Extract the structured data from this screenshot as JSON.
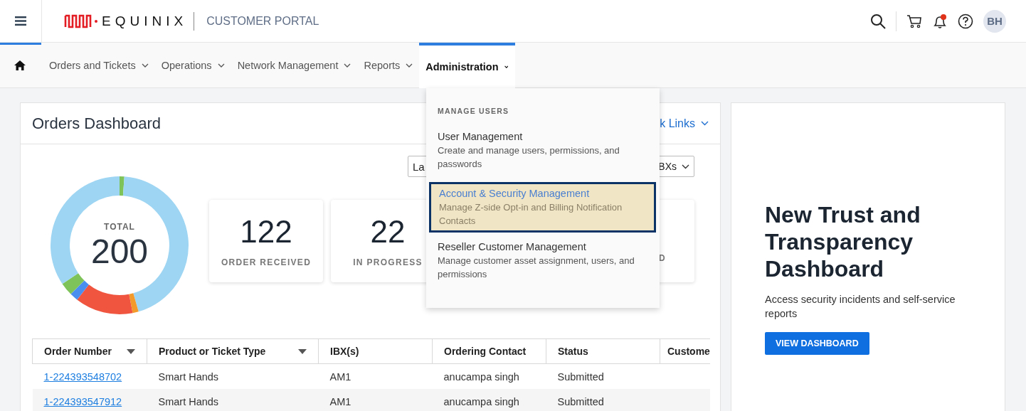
{
  "header": {
    "brand": "EQUINIX",
    "product": "CUSTOMER PORTAL",
    "avatar": "BH",
    "notification_dot": true
  },
  "nav": {
    "tabs": [
      {
        "label": "Orders and Tickets",
        "selected": false
      },
      {
        "label": "Operations",
        "selected": false
      },
      {
        "label": "Network Management",
        "selected": false
      },
      {
        "label": "Reports",
        "selected": false
      },
      {
        "label": "Administration",
        "selected": true
      }
    ]
  },
  "admin_menu": {
    "section": "MANAGE USERS",
    "items": [
      {
        "title": "User Management",
        "description": "Create and manage users, permissions, and passwords",
        "highlighted": false
      },
      {
        "title": "Account & Security Management",
        "description": "Manage Z-side Opt-in and Billing Notification Contacts",
        "highlighted": true
      },
      {
        "title": "Reseller Customer Management",
        "description": "Manage customer asset assignment, users, and permissions",
        "highlighted": false
      }
    ]
  },
  "dashboard": {
    "title": "Orders Dashboard",
    "quick_links": "k Links",
    "filters": [
      "La",
      "BXs"
    ],
    "total_label": "TOTAL",
    "total": "200",
    "stats": [
      {
        "value": "122",
        "label": "ORDER RECEIVED"
      },
      {
        "value": "22",
        "label": "IN PROGRESS"
      },
      {
        "label": "D"
      }
    ],
    "table": {
      "columns": [
        {
          "label": "Order Number",
          "sortable": true
        },
        {
          "label": "Product or Ticket Type",
          "sortable": true
        },
        {
          "label": "IBX(s)",
          "sortable": false
        },
        {
          "label": "Ordering Contact",
          "sortable": false
        },
        {
          "label": "Status",
          "sortable": false
        },
        {
          "label": "Custome"
        }
      ],
      "rows": [
        [
          "1-224393548702",
          "Smart Hands",
          "AM1",
          "anucampa singh",
          "Submitted"
        ],
        [
          "1-224393547912",
          "Smart Hands",
          "AM1",
          "anucampa singh",
          "Submitted"
        ]
      ]
    }
  },
  "promo": {
    "title": "New Trust and Transparency Dashboard",
    "text": "Access security incidents and self-service reports",
    "button": "VIEW DASHBOARD"
  }
}
